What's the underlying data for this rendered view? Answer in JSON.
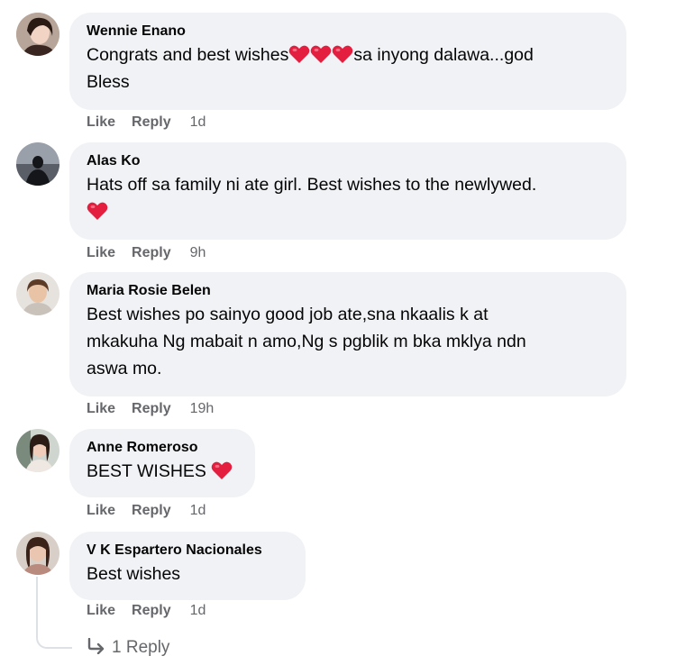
{
  "comments": [
    {
      "author": "Wennie Enano",
      "text_line1_prefix": "Congrats and best wishes",
      "text_line1_suffix": "sa inyong dalawa...god",
      "text_line2": "Bless",
      "like": "Like",
      "reply": "Reply",
      "time": "1d",
      "avatar_icon": "profile-photo-woman"
    },
    {
      "author": "Alas Ko",
      "text": "Hats off sa family ni ate girl. Best wishes to the newlywed.",
      "like": "Like",
      "reply": "Reply",
      "time": "9h",
      "avatar_icon": "profile-photo-silhouette"
    },
    {
      "author": "Maria Rosie Belen",
      "text_line1": "Best wishes po sainyo good job ate,sna nkaalis k at",
      "text_line2": "mkakuha Ng mabait n amo,Ng s pgblik m bka mklya ndn",
      "text_line3": "aswa mo.",
      "like": "Like",
      "reply": "Reply",
      "time": "19h",
      "avatar_icon": "profile-photo-woman"
    },
    {
      "author": "Anne Romeroso",
      "text": "BEST WISHES",
      "like": "Like",
      "reply": "Reply",
      "time": "1d",
      "avatar_icon": "profile-photo-woman"
    },
    {
      "author": "V K Espartero Nacionales",
      "text": "Best wishes",
      "like": "Like",
      "reply": "Reply",
      "time": "1d",
      "avatar_icon": "profile-photo-woman"
    }
  ],
  "replies_link": "1 Reply",
  "colors": {
    "bubble": "#f0f2f5",
    "action_text": "#65676b",
    "heart": "#e41e3f"
  }
}
